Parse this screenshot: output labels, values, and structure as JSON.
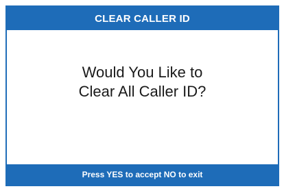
{
  "header": {
    "title": "CLEAR CALLER ID"
  },
  "prompt": {
    "line1": "Would You Like to",
    "line2": "Clear All Caller ID?"
  },
  "footer": {
    "instruction": "Press YES to accept NO to exit"
  },
  "colors": {
    "bar": "#1e6cb8",
    "background": "#ffffff",
    "text": "#1a1a1a"
  }
}
